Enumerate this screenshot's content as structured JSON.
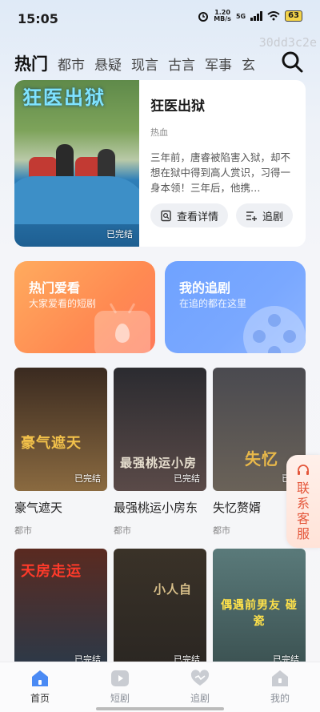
{
  "status": {
    "time": "15:05",
    "net_speed": "1.20",
    "net_unit": "MB/s",
    "net_type": "5G",
    "battery": "63"
  },
  "watermark": "30dd3c2e",
  "tabs": [
    "热门",
    "都市",
    "悬疑",
    "现言",
    "古言",
    "军事",
    "玄"
  ],
  "featured": {
    "poster_title": "狂医出狱",
    "badge": "已完结",
    "title": "狂医出狱",
    "tag": "热血",
    "desc": "三年前，唐睿被陷害入狱，却不想在狱中得到高人赏识，习得一身本领！三年后，他携…",
    "detail_label": "查看详情",
    "follow_label": "追剧"
  },
  "cards": {
    "hot": {
      "title": "热门爱看",
      "subtitle": "大家爱看的短剧"
    },
    "follow": {
      "title": "我的追剧",
      "subtitle": "在追的都在这里"
    }
  },
  "dramas": [
    {
      "name": "豪气遮天",
      "genre": "都市",
      "badge": "已完结",
      "poster_text": "豪气遮天",
      "color_top": "#3a2a20",
      "color_bottom": "#8a6a40",
      "text_color": "#f2c14a"
    },
    {
      "name": "最强桃运小房东",
      "genre": "都市",
      "badge": "已完结",
      "poster_text": "最强桃运小房",
      "color_top": "#2b2b30",
      "color_bottom": "#5a4a48",
      "text_color": "#e8e0d0"
    },
    {
      "name": "失忆赘婿",
      "genre": "都市",
      "badge": "已完",
      "poster_text": "失忆",
      "color_top": "#4a4a50",
      "color_bottom": "#6a6258",
      "text_color": "#e8b84a"
    },
    {
      "name": "",
      "genre": "",
      "badge": "已完结",
      "poster_text": "天房走运",
      "color_top": "#5a2a20",
      "color_bottom": "#2a3a4a",
      "text_color": "#ff3a2a"
    },
    {
      "name": "",
      "genre": "",
      "badge": "已完结",
      "poster_text": "小人自",
      "color_top": "#3a3228",
      "color_bottom": "#2a2622",
      "text_color": "#d9c08a"
    },
    {
      "name": "",
      "genre": "",
      "badge": "已完结",
      "poster_text": "偶遇前男友 碰瓷",
      "color_top": "#5a7a7a",
      "color_bottom": "#3a5050",
      "text_color": "#ffe24a"
    }
  ],
  "service": {
    "label": "联系客服"
  },
  "bottom_nav": [
    {
      "label": "首页",
      "icon": "home-icon",
      "active": true
    },
    {
      "label": "短剧",
      "icon": "play-icon",
      "active": false
    },
    {
      "label": "追剧",
      "icon": "heart-icon",
      "active": false
    },
    {
      "label": "我的",
      "icon": "profile-icon",
      "active": false
    }
  ],
  "colors": {
    "accent_blue": "#4a8af4",
    "hot_card": "#ff8a52",
    "follow_card": "#6fa2ff",
    "service_text": "#e4573b"
  }
}
